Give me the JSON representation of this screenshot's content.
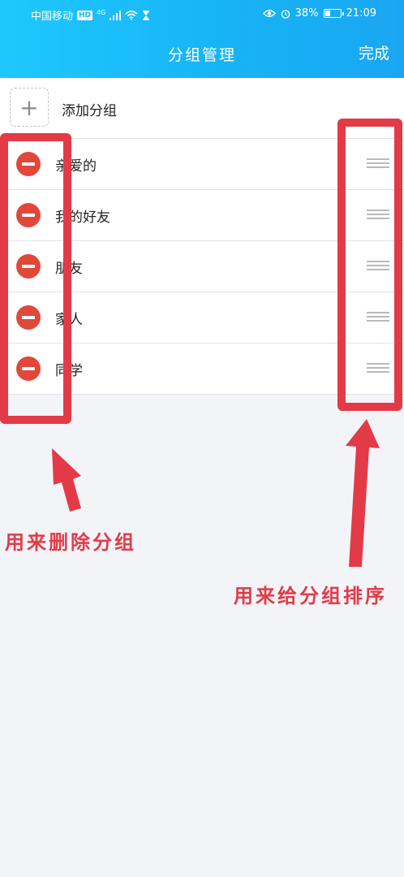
{
  "status_bar": {
    "carrier": "中国移动",
    "hd": "HD",
    "network": "4G",
    "battery_percent": "38%",
    "battery_level": 0.38,
    "time": "21:09"
  },
  "header": {
    "title": "分组管理",
    "done_label": "完成"
  },
  "add_group": {
    "icon": "plus-icon",
    "label": "添加分组"
  },
  "groups": [
    {
      "label": "亲爱的"
    },
    {
      "label": "我的好友"
    },
    {
      "label": "朋友"
    },
    {
      "label": "家人"
    },
    {
      "label": "同学"
    }
  ],
  "annotations": {
    "delete_note": "用来删除分组",
    "sort_note": "用来给分组排序",
    "color": "#e33a48"
  },
  "colors": {
    "header_gradient_start": "#1ec8ff",
    "header_gradient_end": "#1aa6f3",
    "delete_red": "#e2483a",
    "background": "#f3f4f8"
  }
}
